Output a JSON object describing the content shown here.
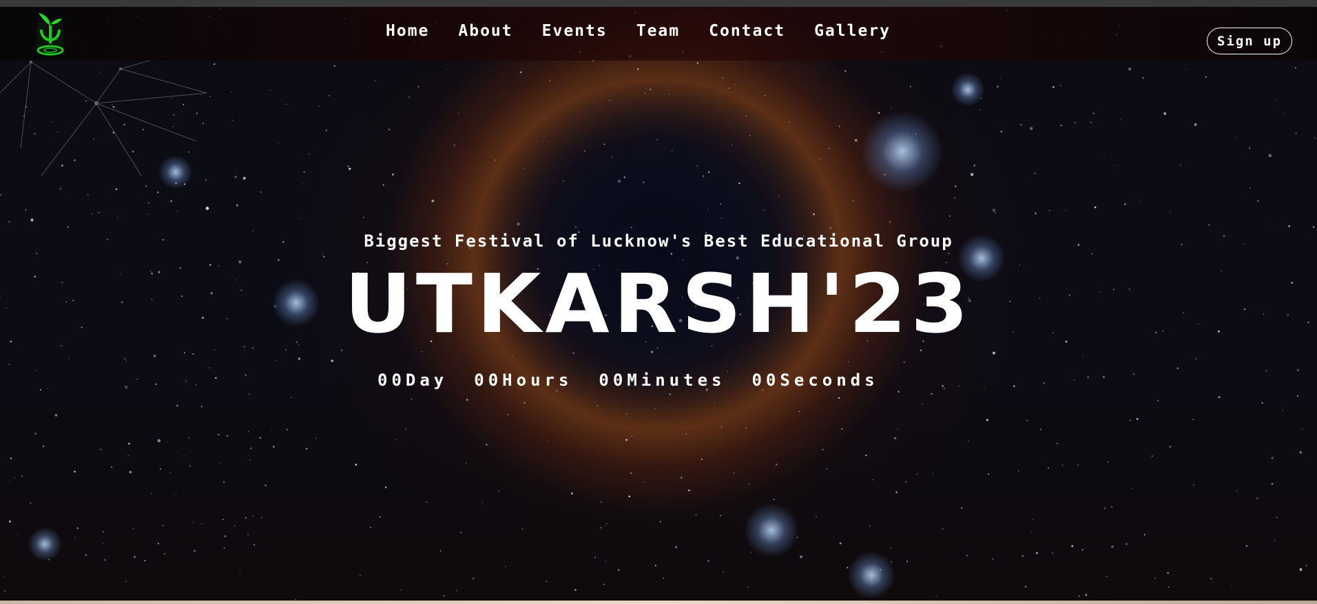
{
  "brand": {
    "logo_icon": "leaf-swirl-logo-icon",
    "accent": "#22c922"
  },
  "nav": {
    "links": [
      "Home",
      "About",
      "Events",
      "Team",
      "Contact",
      "Gallery"
    ],
    "signup_label": "Sign up"
  },
  "hero": {
    "tagline": "Biggest Festival of Lucknow's Best Educational Group",
    "title": "UTKARSH'23",
    "countdown": [
      {
        "value": "00",
        "unit": "Day"
      },
      {
        "value": "00",
        "unit": "Hours"
      },
      {
        "value": "00",
        "unit": "Minutes"
      },
      {
        "value": "00",
        "unit": "Seconds"
      }
    ]
  }
}
